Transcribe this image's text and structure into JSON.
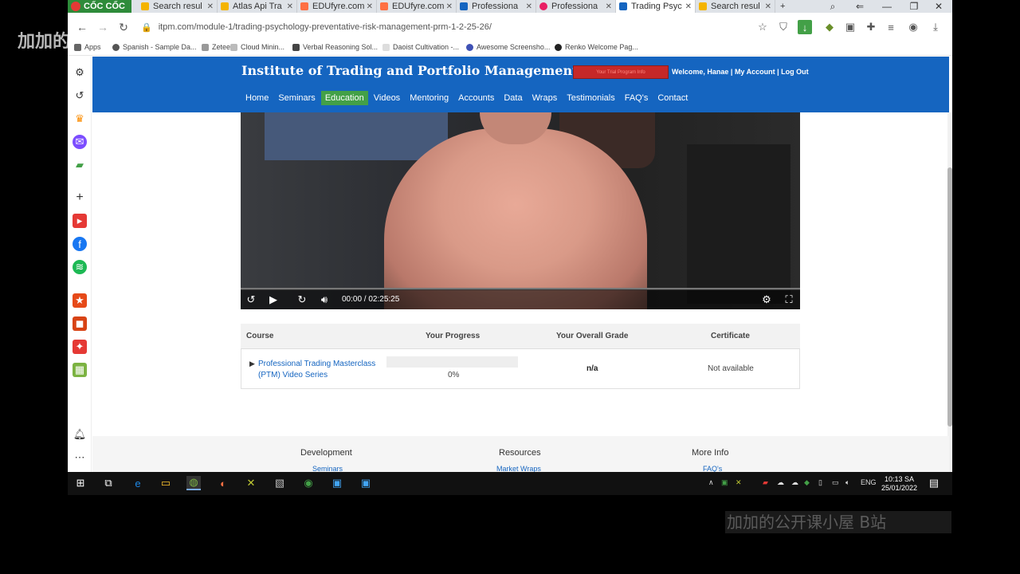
{
  "watermark": {
    "top_text": "加加的",
    "bottom_text": "加加的公开课小屋 B站"
  },
  "browser": {
    "brand_label": "CỐC CỐC",
    "tabs": [
      {
        "label": "Search resul",
        "color": "#f4b400"
      },
      {
        "label": "Atlas Api Tra",
        "color": "#f4b400"
      },
      {
        "label": "EDUfyre.com",
        "color": "#ff7043"
      },
      {
        "label": "EDUfyre.com",
        "color": "#ff7043"
      },
      {
        "label": "Professiona",
        "color": "#1565c0"
      },
      {
        "label": "Professiona",
        "color": "#e91e63"
      },
      {
        "label": "Trading Psyc",
        "color": "#1565c0",
        "active": true
      },
      {
        "label": "Search resul",
        "color": "#f4b400"
      }
    ],
    "new_tab_label": "+",
    "url": "itpm.com/module-1/trading-psychology-preventative-risk-management-prm-1-2-25-26/",
    "bookmarks": [
      "Apps",
      "Spanish - Sample Da...",
      "Zetee",
      "Cloud Minin...",
      "Verbal Reasoning Sol...",
      "Daoist Cultivation -...",
      "Awesome Screensho...",
      "Renko Welcome Pag..."
    ]
  },
  "site": {
    "title": "Institute of Trading and Portfolio Management",
    "badge_text": "Your Trial Program Info",
    "welcome": "Welcome, Hanae",
    "my_account": "My Account",
    "log_out": "Log Out",
    "separator": "|",
    "nav": [
      {
        "label": "Home"
      },
      {
        "label": "Seminars"
      },
      {
        "label": "Education",
        "active": true
      },
      {
        "label": "Videos"
      },
      {
        "label": "Mentoring"
      },
      {
        "label": "Accounts"
      },
      {
        "label": "Data"
      },
      {
        "label": "Wraps"
      },
      {
        "label": "Testimonials"
      },
      {
        "label": "FAQ's"
      },
      {
        "label": "Contact"
      }
    ]
  },
  "video": {
    "time": "00:00 / 02:25:25",
    "progress": 0
  },
  "course_table": {
    "headers": [
      "Course",
      "Your Progress",
      "Your Overall Grade",
      "Certificate"
    ],
    "row": {
      "course": "Professional Trading Masterclass (PTM) Video Series",
      "progress_label": "0%",
      "progress": 0,
      "grade": "n/a",
      "certificate": "Not available"
    }
  },
  "footer": {
    "columns": [
      {
        "heading": "Development",
        "link": "Seminars"
      },
      {
        "heading": "Resources",
        "link": "Market Wraps"
      },
      {
        "heading": "More Info",
        "link": "FAQ's"
      }
    ]
  },
  "taskbar": {
    "lang": "ENG",
    "time": "10:13 SA",
    "date": "25/01/2022"
  }
}
